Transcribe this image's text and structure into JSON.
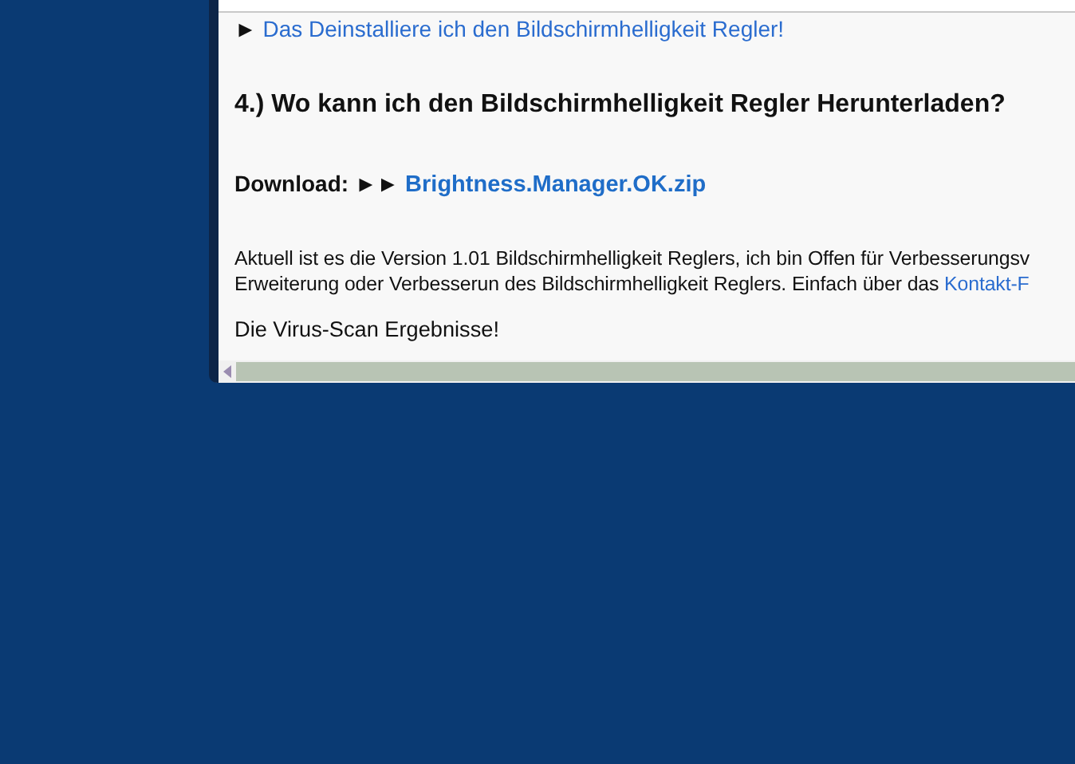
{
  "uninstall_link": {
    "marker": "►",
    "text": "Das Deinstalliere ich den Bildschirmhelligkeit Regler!"
  },
  "heading": "4.) Wo kann ich den Bildschirmhelligkeit Regler Herunterladen?",
  "download": {
    "label": "Download:",
    "marker": "►►",
    "link": "Brightness.Manager.OK.zip"
  },
  "paragraph": {
    "lines": [
      "Aktuell ist es die Version 1.01 Bildschirmhelligkeit Reglers, ich bin Offen für Verbesserungsv",
      "Erweiterung oder Verbesserun des Bildschirmhelligkeit Reglers. Einfach über das "
    ],
    "link": "Kontakt-F"
  },
  "virus_scan": "Die Virus-Scan Ergebnisse!"
}
